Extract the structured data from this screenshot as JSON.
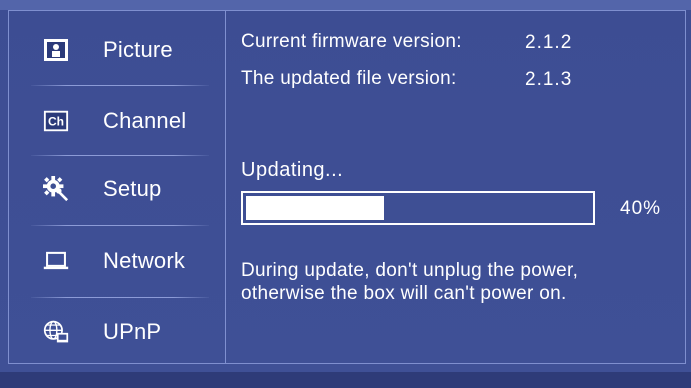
{
  "sidebar": {
    "items": [
      {
        "label": "Picture",
        "icon": "picture-icon"
      },
      {
        "label": "Channel",
        "icon": "channel-icon"
      },
      {
        "label": "Setup",
        "icon": "setup-icon"
      },
      {
        "label": "Network",
        "icon": "network-icon"
      },
      {
        "label": "UPnP",
        "icon": "upnp-icon"
      }
    ]
  },
  "firmware": {
    "current_label": "Current firmware version:",
    "current_value": "2.1.2",
    "updated_label": "The updated file version:",
    "updated_value": "2.1.3"
  },
  "update": {
    "status": "Updating...",
    "progress_percent": 40,
    "progress_text": "40%",
    "warning_line1": "During update, don't unplug the power,",
    "warning_line2": "otherwise the box will can't power on."
  },
  "colors": {
    "background": "#3e4f94",
    "text": "#ffffff",
    "border": "#7f8fcf"
  }
}
